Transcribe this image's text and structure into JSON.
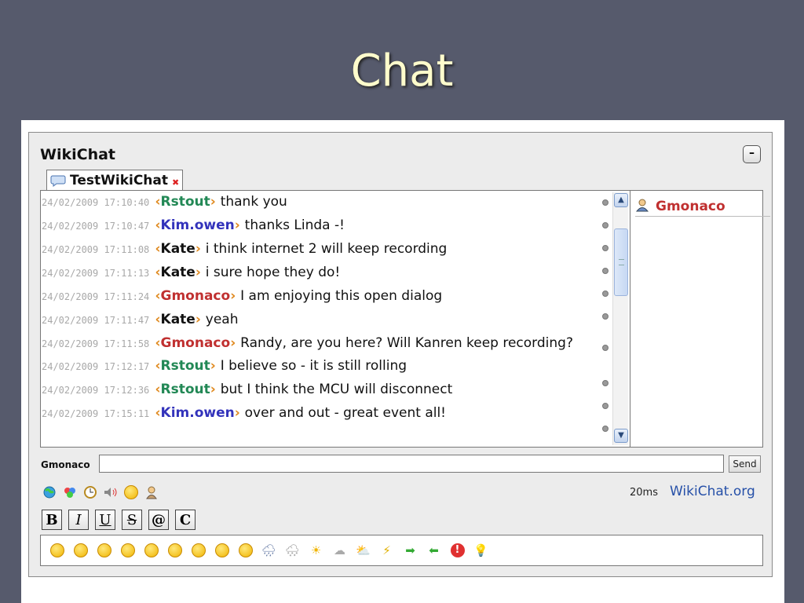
{
  "slide": {
    "title": "Chat"
  },
  "widget": {
    "title": "WikiChat",
    "minimize_label": "–",
    "tab": {
      "label": "TestWikiChat",
      "close": "✖"
    }
  },
  "messages": [
    {
      "ts": "24/02/2009 17:10:40",
      "nick": "Rstout",
      "color": "#228855",
      "text": "thank you"
    },
    {
      "ts": "24/02/2009 17:10:47",
      "nick": "Kim.owen",
      "color": "#3333bb",
      "text": "thanks Linda -!"
    },
    {
      "ts": "24/02/2009 17:11:08",
      "nick": "Kate",
      "color": "#111111",
      "text": "i think internet 2 will keep recording"
    },
    {
      "ts": "24/02/2009 17:11:13",
      "nick": "Kate",
      "color": "#111111",
      "text": "i sure hope they do!"
    },
    {
      "ts": "24/02/2009 17:11:24",
      "nick": "Gmonaco",
      "color": "#c03030",
      "text": "I am enjoying this open dialog"
    },
    {
      "ts": "24/02/2009 17:11:47",
      "nick": "Kate",
      "color": "#111111",
      "text": "yeah"
    },
    {
      "ts": "24/02/2009 17:11:58",
      "nick": "Gmonaco",
      "color": "#c03030",
      "text": "Randy, are you here?  Will Kanren keep recording?"
    },
    {
      "ts": "24/02/2009 17:12:17",
      "nick": "Rstout",
      "color": "#228855",
      "text": "I believe so - it is still rolling"
    },
    {
      "ts": "24/02/2009 17:12:36",
      "nick": "Rstout",
      "color": "#228855",
      "text": "but I think the MCU will disconnect"
    },
    {
      "ts": "24/02/2009 17:15:11",
      "nick": "Kim.owen",
      "color": "#3333bb",
      "text": "over and out - great event all!"
    }
  ],
  "users": [
    {
      "name": "Gmonaco"
    }
  ],
  "input": {
    "label": "Gmonaco",
    "value": "",
    "send_label": "Send"
  },
  "status": {
    "ping": "20ms",
    "link": "WikiChat.org"
  },
  "format_buttons": [
    "B",
    "I",
    "U",
    "S",
    "@",
    "C"
  ],
  "tool_icons": [
    "globe-icon",
    "palette-icon",
    "clock-icon",
    "sound-icon",
    "smiley-icon",
    "user-icon"
  ],
  "emoticons": [
    "smile",
    "grin",
    "laugh",
    "happy",
    "sad",
    "neutral",
    "cool",
    "wink",
    "tongue",
    "rain",
    "snow",
    "sun",
    "cloud",
    "partly-sunny",
    "lightning",
    "arrow-right",
    "arrow-left",
    "warning",
    "idea"
  ]
}
